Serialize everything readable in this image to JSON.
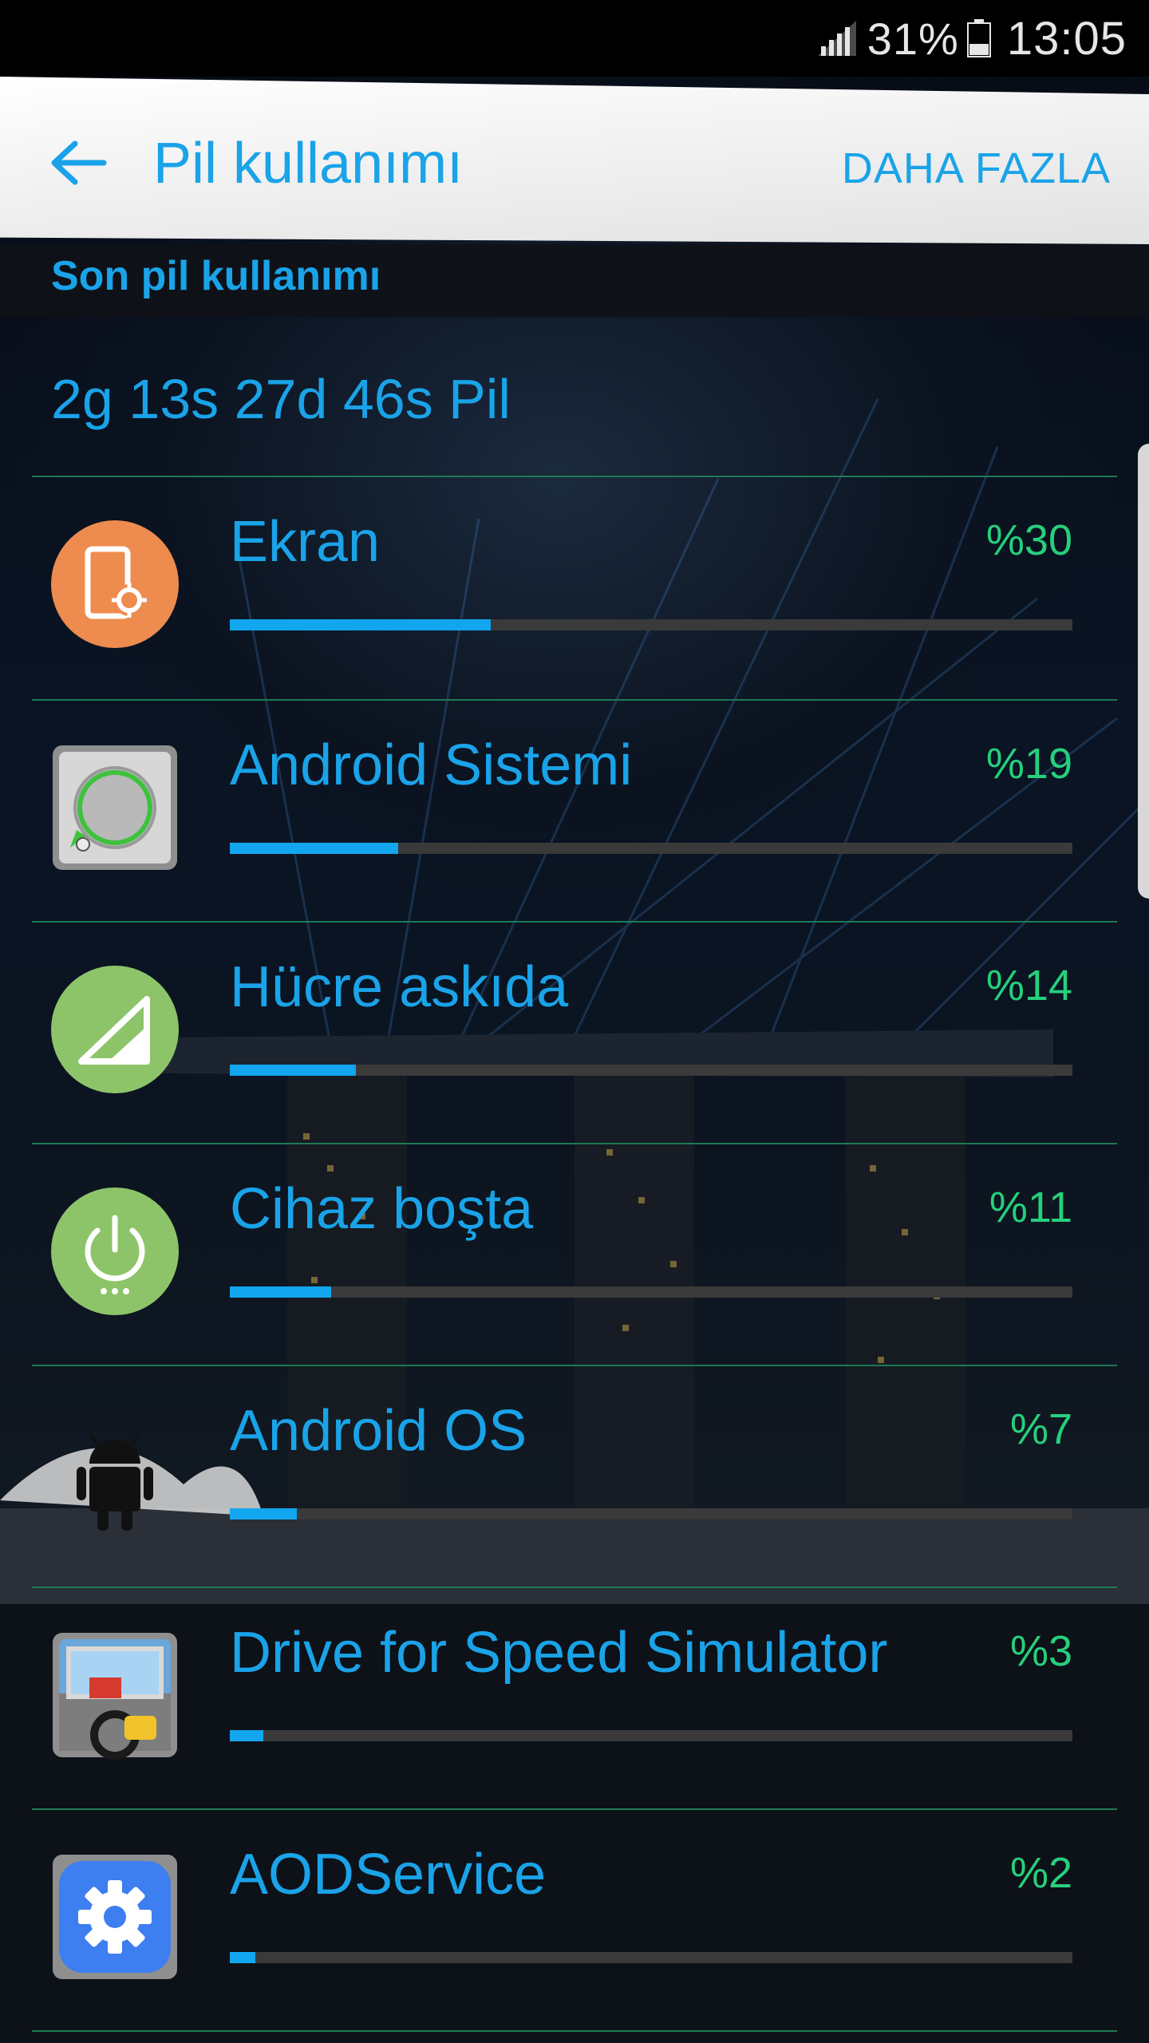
{
  "status_bar": {
    "battery_percent": "31%",
    "time": "13:05",
    "signal_icon": "signal-bars-icon",
    "battery_icon": "battery-icon"
  },
  "app_bar": {
    "title": "Pil kullanımı",
    "more_label": "DAHA FAZLA",
    "back_icon": "arrow-left-icon"
  },
  "section_header": "Son pil kullanımı",
  "summary": "2g 13s 27d 46s Pil",
  "colors": {
    "accent": "#1aa3e8",
    "percent": "#26d07c",
    "track": "#3a3a3a",
    "divider": "#1d7a54"
  },
  "items": [
    {
      "label": "Ekran",
      "percent_text": "%30",
      "usage_fraction": 0.31,
      "icon": "screen-settings-icon"
    },
    {
      "label": "Android Sistemi",
      "percent_text": "%19",
      "usage_fraction": 0.2,
      "icon": "android-system-icon"
    },
    {
      "label": "Hücre askıda",
      "percent_text": "%14",
      "usage_fraction": 0.15,
      "icon": "cell-signal-icon"
    },
    {
      "label": "Cihaz boşta",
      "percent_text": "%11",
      "usage_fraction": 0.12,
      "icon": "power-idle-icon"
    },
    {
      "label": "Android OS",
      "percent_text": "%7",
      "usage_fraction": 0.08,
      "icon": "android-robot-icon"
    },
    {
      "label": "Drive for Speed Simulator",
      "percent_text": "%3",
      "usage_fraction": 0.04,
      "icon": "car-game-icon"
    },
    {
      "label": "AODService",
      "percent_text": "%2",
      "usage_fraction": 0.03,
      "icon": "gear-icon"
    }
  ]
}
